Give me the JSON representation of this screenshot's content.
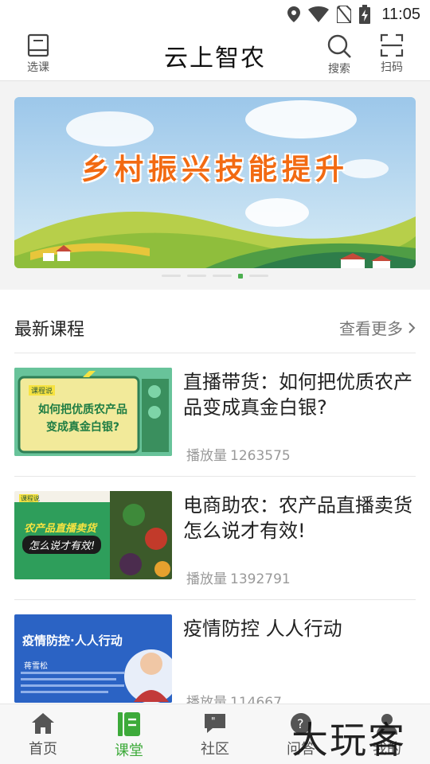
{
  "status_bar": {
    "time": "11:05",
    "icons": [
      "location-icon",
      "wifi-icon",
      "no-sim-icon",
      "battery-charging-icon"
    ]
  },
  "header": {
    "title": "云上智农",
    "left_button": {
      "label": "选课",
      "icon": "book-icon"
    },
    "right_buttons": [
      {
        "label": "搜索",
        "icon": "search-icon"
      },
      {
        "label": "扫码",
        "icon": "scan-icon"
      }
    ]
  },
  "banner": {
    "text": "乡村振兴技能提升",
    "slide_count": 5,
    "active_index": 3
  },
  "latest": {
    "title": "最新课程",
    "more_label": "查看更多",
    "plays_label": "播放量",
    "courses": [
      {
        "title": "直播带货：如何把优质农产品变成真金白银?",
        "plays": "1263575",
        "thumb_badge": "课程说",
        "thumb_line1": "如何把优质农产品",
        "thumb_line2": "变成真金白银?"
      },
      {
        "title": "电商助农：农产品直播卖货怎么说才有效!",
        "plays": "1392791",
        "thumb_badge": "课程说",
        "thumb_line1": "农产品直播卖货",
        "thumb_line2": "怎么说才有效!"
      },
      {
        "title": "疫情防控 人人行动",
        "plays": "114667",
        "thumb_line1": "疫情防控·人人行动",
        "thumb_name": "蒋雪松"
      }
    ]
  },
  "tabbar": {
    "items": [
      {
        "label": "首页",
        "icon": "home-icon",
        "active": false
      },
      {
        "label": "课堂",
        "icon": "classroom-icon",
        "active": true
      },
      {
        "label": "社区",
        "icon": "community-icon",
        "active": false
      },
      {
        "label": "问答",
        "icon": "qa-icon",
        "active": false
      },
      {
        "label": "我的",
        "icon": "profile-icon",
        "active": false
      }
    ]
  },
  "watermark": {
    "text": "大玩客"
  },
  "colors": {
    "accent": "#3daa3a",
    "banner_text": "#f26a12",
    "muted": "#999999"
  }
}
